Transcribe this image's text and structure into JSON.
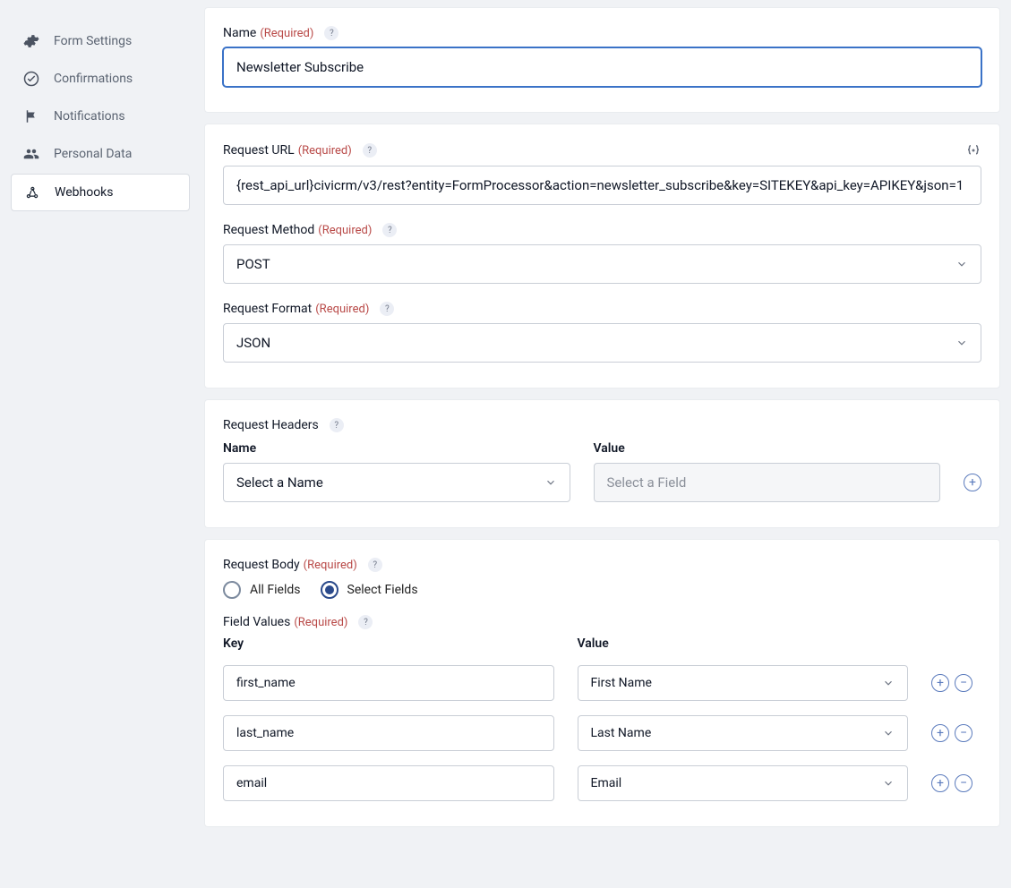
{
  "sidebar": {
    "items": [
      {
        "label": "Form Settings"
      },
      {
        "label": "Confirmations"
      },
      {
        "label": "Notifications"
      },
      {
        "label": "Personal Data"
      },
      {
        "label": "Webhooks"
      }
    ]
  },
  "required_label": "(Required)",
  "name_section": {
    "label": "Name",
    "value": "Newsletter Subscribe"
  },
  "url_section": {
    "label": "Request URL",
    "value": "{rest_api_url}civicrm/v3/rest?entity=FormProcessor&action=newsletter_subscribe&key=SITEKEY&api_key=APIKEY&json=1"
  },
  "method_section": {
    "label": "Request Method",
    "value": "POST"
  },
  "format_section": {
    "label": "Request Format",
    "value": "JSON"
  },
  "headers_section": {
    "label": "Request Headers",
    "name_col": "Name",
    "value_col": "Value",
    "name_placeholder": "Select a Name",
    "value_placeholder": "Select a Field"
  },
  "body_section": {
    "label": "Request Body",
    "radio_all": "All Fields",
    "radio_select": "Select Fields",
    "field_values_label": "Field Values",
    "key_col": "Key",
    "value_col": "Value",
    "rows": [
      {
        "key": "first_name",
        "value": "First Name"
      },
      {
        "key": "last_name",
        "value": "Last Name"
      },
      {
        "key": "email",
        "value": "Email"
      }
    ]
  }
}
